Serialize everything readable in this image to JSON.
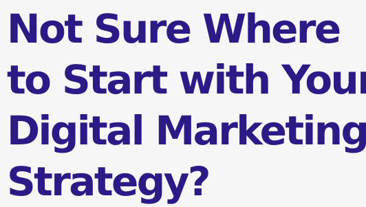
{
  "hero": {
    "headline_lines": [
      "Not Sure Where",
      "to Start with Your",
      "Digital Marketing",
      "Strategy?"
    ]
  },
  "colors": {
    "background": "#f7f6f6",
    "headline": "#2c1a86"
  }
}
